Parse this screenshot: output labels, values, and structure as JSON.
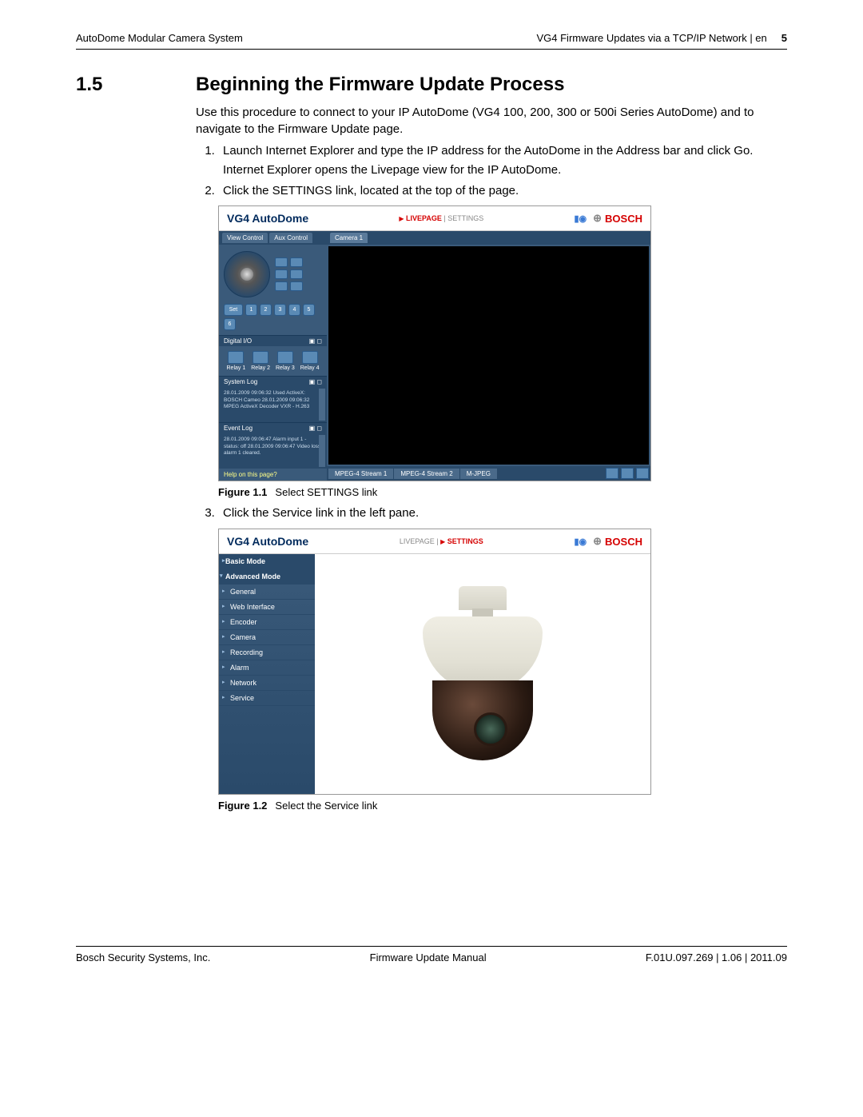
{
  "header": {
    "left": "AutoDome Modular Camera System",
    "right_title": "VG4 Firmware Updates via a TCP/IP Network | en",
    "page_number": "5"
  },
  "section": {
    "number": "1.5",
    "title": "Beginning the Firmware Update Process",
    "intro": "Use this procedure to connect to your IP AutoDome (VG4 100, 200, 300 or 500i Series AutoDome) and to navigate to the Firmware Update page.",
    "steps": {
      "s1": "Launch Internet Explorer and type the IP address for the AutoDome in the Address bar and click Go.",
      "s1b": "Internet Explorer opens the Livepage view for the IP AutoDome.",
      "s2": "Click the SETTINGS link, located at the top of the page.",
      "s3": "Click the Service link in the left pane."
    }
  },
  "fig1": {
    "caption_label": "Figure 1.1",
    "caption_text": "Select SETTINGS link",
    "brand": "VG4 AutoDome",
    "link_live": "LIVEPAGE",
    "link_settings": "SETTINGS",
    "bosch": "BOSCH",
    "tab_view": "View Control",
    "tab_aux": "Aux Control",
    "tab_cam": "Camera 1",
    "set": "Set",
    "presets": [
      "1",
      "2",
      "3",
      "4",
      "5",
      "6"
    ],
    "digital_io": "Digital I/O",
    "relays": [
      "Relay 1",
      "Relay 2",
      "Relay 3",
      "Relay 4"
    ],
    "system_log": "System Log",
    "syslog_text": "28.01.2009 09:06:32 Used ActiveX: BOSCH Cameo\n28.01.2009 09:06:32 MPEG ActiveX Decoder VXR - H.263",
    "event_log": "Event Log",
    "eventlog_text": "28.01.2009 09:06:47 Alarm input 1 - status: off\n28.01.2009 09:06:47 Video loss alarm 1 cleared.",
    "help": "Help on this page?",
    "stream1": "MPEG-4 Stream 1",
    "stream2": "MPEG-4 Stream 2",
    "mjpeg": "M-JPEG"
  },
  "fig2": {
    "caption_label": "Figure 1.2",
    "caption_text": "Select the Service link",
    "brand": "VG4 AutoDome",
    "link_live": "LIVEPAGE",
    "link_settings": "SETTINGS",
    "bosch": "BOSCH",
    "nav": {
      "basic": "Basic Mode",
      "advanced": "Advanced Mode",
      "general": "General",
      "web": "Web Interface",
      "encoder": "Encoder",
      "camera": "Camera",
      "recording": "Recording",
      "alarm": "Alarm",
      "network": "Network",
      "service": "Service"
    }
  },
  "footer": {
    "left": "Bosch Security Systems, Inc.",
    "center": "Firmware Update Manual",
    "right": "F.01U.097.269 | 1.06 | 2011.09"
  }
}
